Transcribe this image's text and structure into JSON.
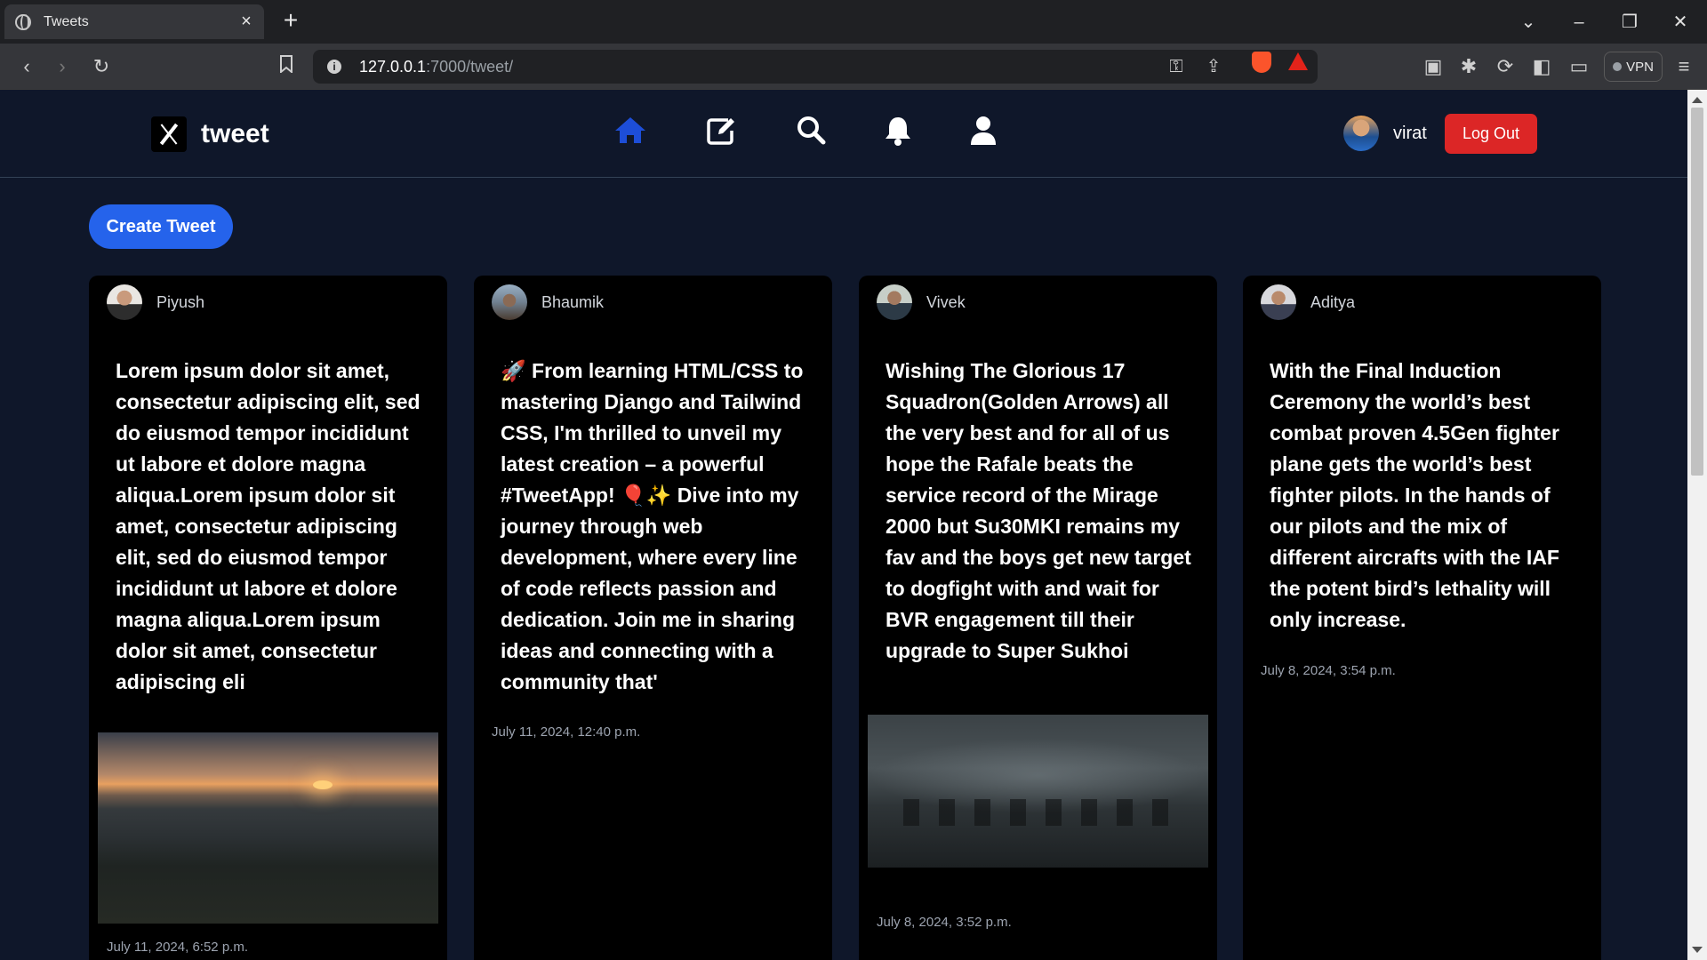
{
  "browser": {
    "tab_title": "Tweets",
    "url_host": "127.0.0.1",
    "url_path": ":7000/tweet/",
    "vpn_label": "VPN"
  },
  "header": {
    "brand": "tweet",
    "nav": [
      "home-icon",
      "edit-icon",
      "search-icon",
      "bell-icon",
      "user-icon"
    ],
    "active_nav_color": "#1d4ed8",
    "username": "virat",
    "logout_label": "Log Out"
  },
  "create_tweet_label": "Create Tweet",
  "tweets": [
    {
      "user": "Piyush",
      "text": "Lorem ipsum dolor sit amet, consectetur adipiscing elit, sed do eiusmod tempor incididunt ut labore et dolore magna aliqua.Lorem ipsum dolor sit amet, consectetur adipiscing elit, sed do eiusmod tempor incididunt ut labore et dolore magna aliqua.Lorem ipsum dolor sit amet, consectetur adipiscing eli",
      "date": "July 11, 2024, 6:52 p.m."
    },
    {
      "user": "Bhaumik",
      "text": "🚀 From learning HTML/CSS to mastering Django and Tailwind CSS, I'm thrilled to unveil my latest creation – a powerful #TweetApp! 🎈✨ Dive into my journey through web development, where every line of code reflects passion and dedication. Join me in sharing ideas and connecting with a community that'",
      "date": "July 11, 2024, 12:40 p.m."
    },
    {
      "user": "Vivek",
      "text": "Wishing The Glorious 17 Squadron(Golden Arrows) all the very best and for all of us hope the Rafale beats the service record of the Mirage 2000 but Su30MKI remains my fav and the boys get new target to dogfight with and wait for BVR engagement till their upgrade to Super Sukhoi",
      "date": "July 8, 2024, 3:52 p.m."
    },
    {
      "user": "Aditya",
      "text": "With the Final Induction Ceremony the world’s best combat proven 4.5Gen fighter plane gets the world’s best fighter pilots. In the hands of our pilots and the mix of different aircrafts with the IAF the potent bird’s lethality will only increase.",
      "date": "July 8, 2024, 3:54 p.m."
    }
  ]
}
